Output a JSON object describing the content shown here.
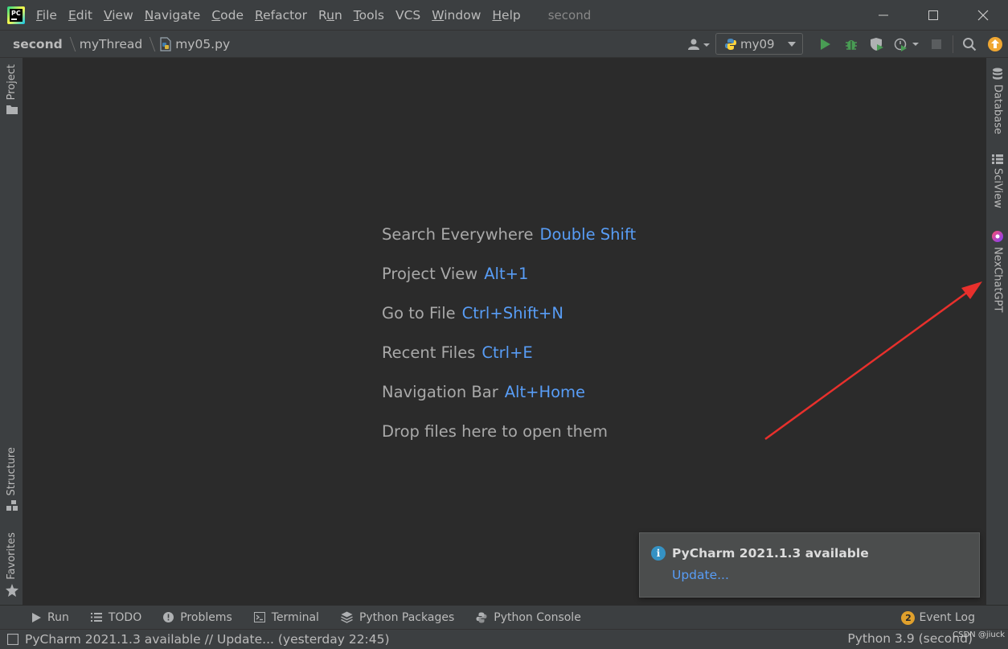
{
  "window": {
    "title": "second",
    "menu": [
      "File",
      "Edit",
      "View",
      "Navigate",
      "Code",
      "Refactor",
      "Run",
      "Tools",
      "VCS",
      "Window",
      "Help"
    ],
    "menu_mnemonics": [
      "F",
      "E",
      "V",
      "N",
      "C",
      "R",
      "u",
      "T",
      "",
      "W",
      "H"
    ],
    "app_logo_text": "PC"
  },
  "breadcrumb": {
    "project": "second",
    "folder": "myThread",
    "file": "my05.py"
  },
  "toolbar": {
    "run_config": "my09"
  },
  "left_tools": {
    "project": "Project",
    "structure": "Structure",
    "favorites": "Favorites"
  },
  "right_tools": {
    "database": "Database",
    "sciview": "SciView",
    "nexchatgpt": "NexChatGPT"
  },
  "editor": {
    "hints": [
      {
        "label": "Search Everywhere",
        "key": "Double Shift"
      },
      {
        "label": "Project View",
        "key": "Alt+1"
      },
      {
        "label": "Go to File",
        "key": "Ctrl+Shift+N"
      },
      {
        "label": "Recent Files",
        "key": "Ctrl+E"
      },
      {
        "label": "Navigation Bar",
        "key": "Alt+Home"
      },
      {
        "label": "Drop files here to open them",
        "key": ""
      }
    ]
  },
  "notification": {
    "title": "PyCharm 2021.1.3 available",
    "link": "Update..."
  },
  "bottom_tools": {
    "run": "Run",
    "todo": "TODO",
    "problems": "Problems",
    "terminal": "Terminal",
    "python_packages": "Python Packages",
    "python_console": "Python Console",
    "event_log": "Event Log",
    "event_log_count": "2"
  },
  "status": {
    "message": "PyCharm 2021.1.3 available // Update... (yesterday 22:45)",
    "interpreter": "Python 3.9 (second)",
    "watermark": "CSDN @jiuck"
  },
  "colors": {
    "accent_link": "#589df6",
    "run_green": "#499c54",
    "annotation_arrow": "#e8302c",
    "badge": "#e0a02c"
  }
}
